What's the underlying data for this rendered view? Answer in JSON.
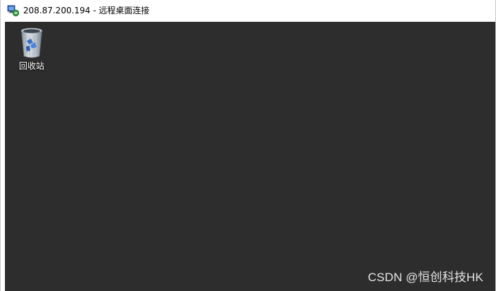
{
  "window": {
    "title": "208.87.200.194 - 远程桌面连接",
    "app_icon": "remote-desktop-icon"
  },
  "desktop": {
    "background_color": "#2d2d2d",
    "icons": [
      {
        "label": "回收站",
        "icon": "recycle-bin-icon"
      }
    ]
  },
  "watermark": {
    "text": "CSDN @恒创科技HK"
  }
}
